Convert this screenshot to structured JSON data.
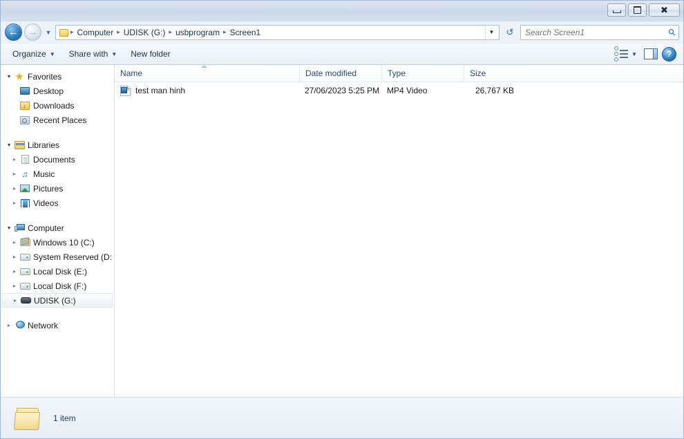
{
  "window": {
    "controls": {
      "minimize_label": "Minimize",
      "maximize_label": "Maximize",
      "close_label": "Close"
    }
  },
  "address_bar": {
    "back_label": "Back",
    "forward_label": "Forward",
    "recent_pages_label": "Recent pages",
    "breadcrumbs": [
      "Computer",
      "UDISK (G:)",
      "usbprogram",
      "Screen1"
    ],
    "separator": "▸",
    "dropdown_label": "Previous locations",
    "refresh_label": "Refresh"
  },
  "search": {
    "placeholder": "Search Screen1",
    "value": "",
    "icon": "search-icon"
  },
  "toolbar": {
    "organize_label": "Organize",
    "share_with_label": "Share with",
    "new_folder_label": "New folder",
    "caret": "▼",
    "change_view_label": "Change your view",
    "preview_pane_label": "Show the preview pane",
    "help_label": "?"
  },
  "sidebar": {
    "groups": [
      {
        "name": "Favorites",
        "icon": "star-icon",
        "expanded": true,
        "items": [
          {
            "label": "Desktop",
            "icon": "desktop-icon"
          },
          {
            "label": "Downloads",
            "icon": "downloads-icon"
          },
          {
            "label": "Recent Places",
            "icon": "recent-places-icon"
          }
        ]
      },
      {
        "name": "Libraries",
        "icon": "libraries-icon",
        "expanded": true,
        "items": [
          {
            "label": "Documents",
            "icon": "documents-icon"
          },
          {
            "label": "Music",
            "icon": "music-icon"
          },
          {
            "label": "Pictures",
            "icon": "pictures-icon"
          },
          {
            "label": "Videos",
            "icon": "videos-icon"
          }
        ]
      },
      {
        "name": "Computer",
        "icon": "computer-icon",
        "expanded": true,
        "items": [
          {
            "label": "Windows 10 (C:)",
            "icon": "windows-drive-icon"
          },
          {
            "label": "System Reserved (D:",
            "icon": "drive-icon"
          },
          {
            "label": "Local Disk (E:)",
            "icon": "drive-icon"
          },
          {
            "label": "Local Disk (F:)",
            "icon": "drive-icon"
          },
          {
            "label": "UDISK (G:)",
            "icon": "usb-drive-icon",
            "selected": true
          }
        ]
      },
      {
        "name": "Network",
        "icon": "network-icon",
        "expanded": false,
        "items": []
      }
    ]
  },
  "file_list": {
    "columns": [
      {
        "label": "Name",
        "key": "name",
        "sorted": "ascending"
      },
      {
        "label": "Date modified",
        "key": "date"
      },
      {
        "label": "Type",
        "key": "type"
      },
      {
        "label": "Size",
        "key": "size"
      }
    ],
    "rows": [
      {
        "name": "test man hinh",
        "date": "27/06/2023 5:25 PM",
        "type": "MP4 Video",
        "size": "26,767 KB",
        "icon": "mp4-video-icon"
      }
    ]
  },
  "status_bar": {
    "item_count": "1 item",
    "folder_icon": "folder-icon"
  },
  "colors": {
    "accent": "#2f7fc4",
    "title_bar": "#cfdcea",
    "frame_border": "#9fb6cd",
    "text": "#1a3c5e"
  }
}
